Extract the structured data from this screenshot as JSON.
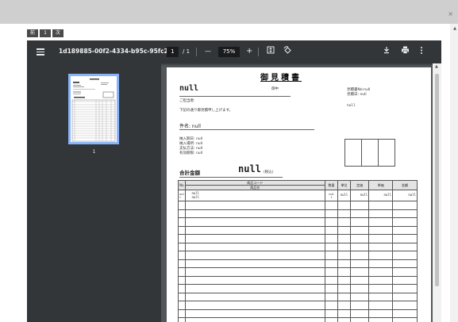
{
  "modal": {
    "close_label": "×",
    "nav": [
      "前",
      "1",
      "次"
    ]
  },
  "toolbar": {
    "doc_title": "1d189885-00f2-4334-b95c-95fc2...",
    "page_current": "1",
    "page_total": "/ 1",
    "zoom_out": "—",
    "zoom": "75%",
    "zoom_in": "+",
    "icons": [
      "menu-icon",
      "fit-page-icon",
      "rotate-icon",
      "download-icon",
      "print-icon",
      "more-icon"
    ]
  },
  "thumbnails": {
    "page_number": "1"
  },
  "document": {
    "title": "御見積書",
    "customer": "null",
    "onchu": "御中",
    "estimate_no": "見積書No:null",
    "estimate_date": "見積日: null",
    "contact": "ご担当者:",
    "intro": "下記の通り御見積申し上げます。",
    "issuer": "null",
    "subject": "件名: null",
    "delivery_date": "納入期日: null",
    "delivery_place": "納入場所: null",
    "payment": "支払方法: null",
    "validity": "有効期限: null",
    "total_label": "合計金額",
    "total_value": "null",
    "tax_note": "(税込)",
    "table": {
      "headers": {
        "no": "No.",
        "product_code": "商品コード",
        "product_name": "商品名",
        "qty": "数量",
        "unit": "単位",
        "list_price": "定価",
        "unit_price": "単価",
        "amount": "金額"
      },
      "row1": {
        "no_top": "nul",
        "no_bottom": "l",
        "code": "null",
        "name": "null",
        "qty_top": "nul",
        "qty_bottom": "l",
        "unit": "null",
        "list_price": "null",
        "unit_price": "null",
        "amount": "null"
      }
    }
  }
}
